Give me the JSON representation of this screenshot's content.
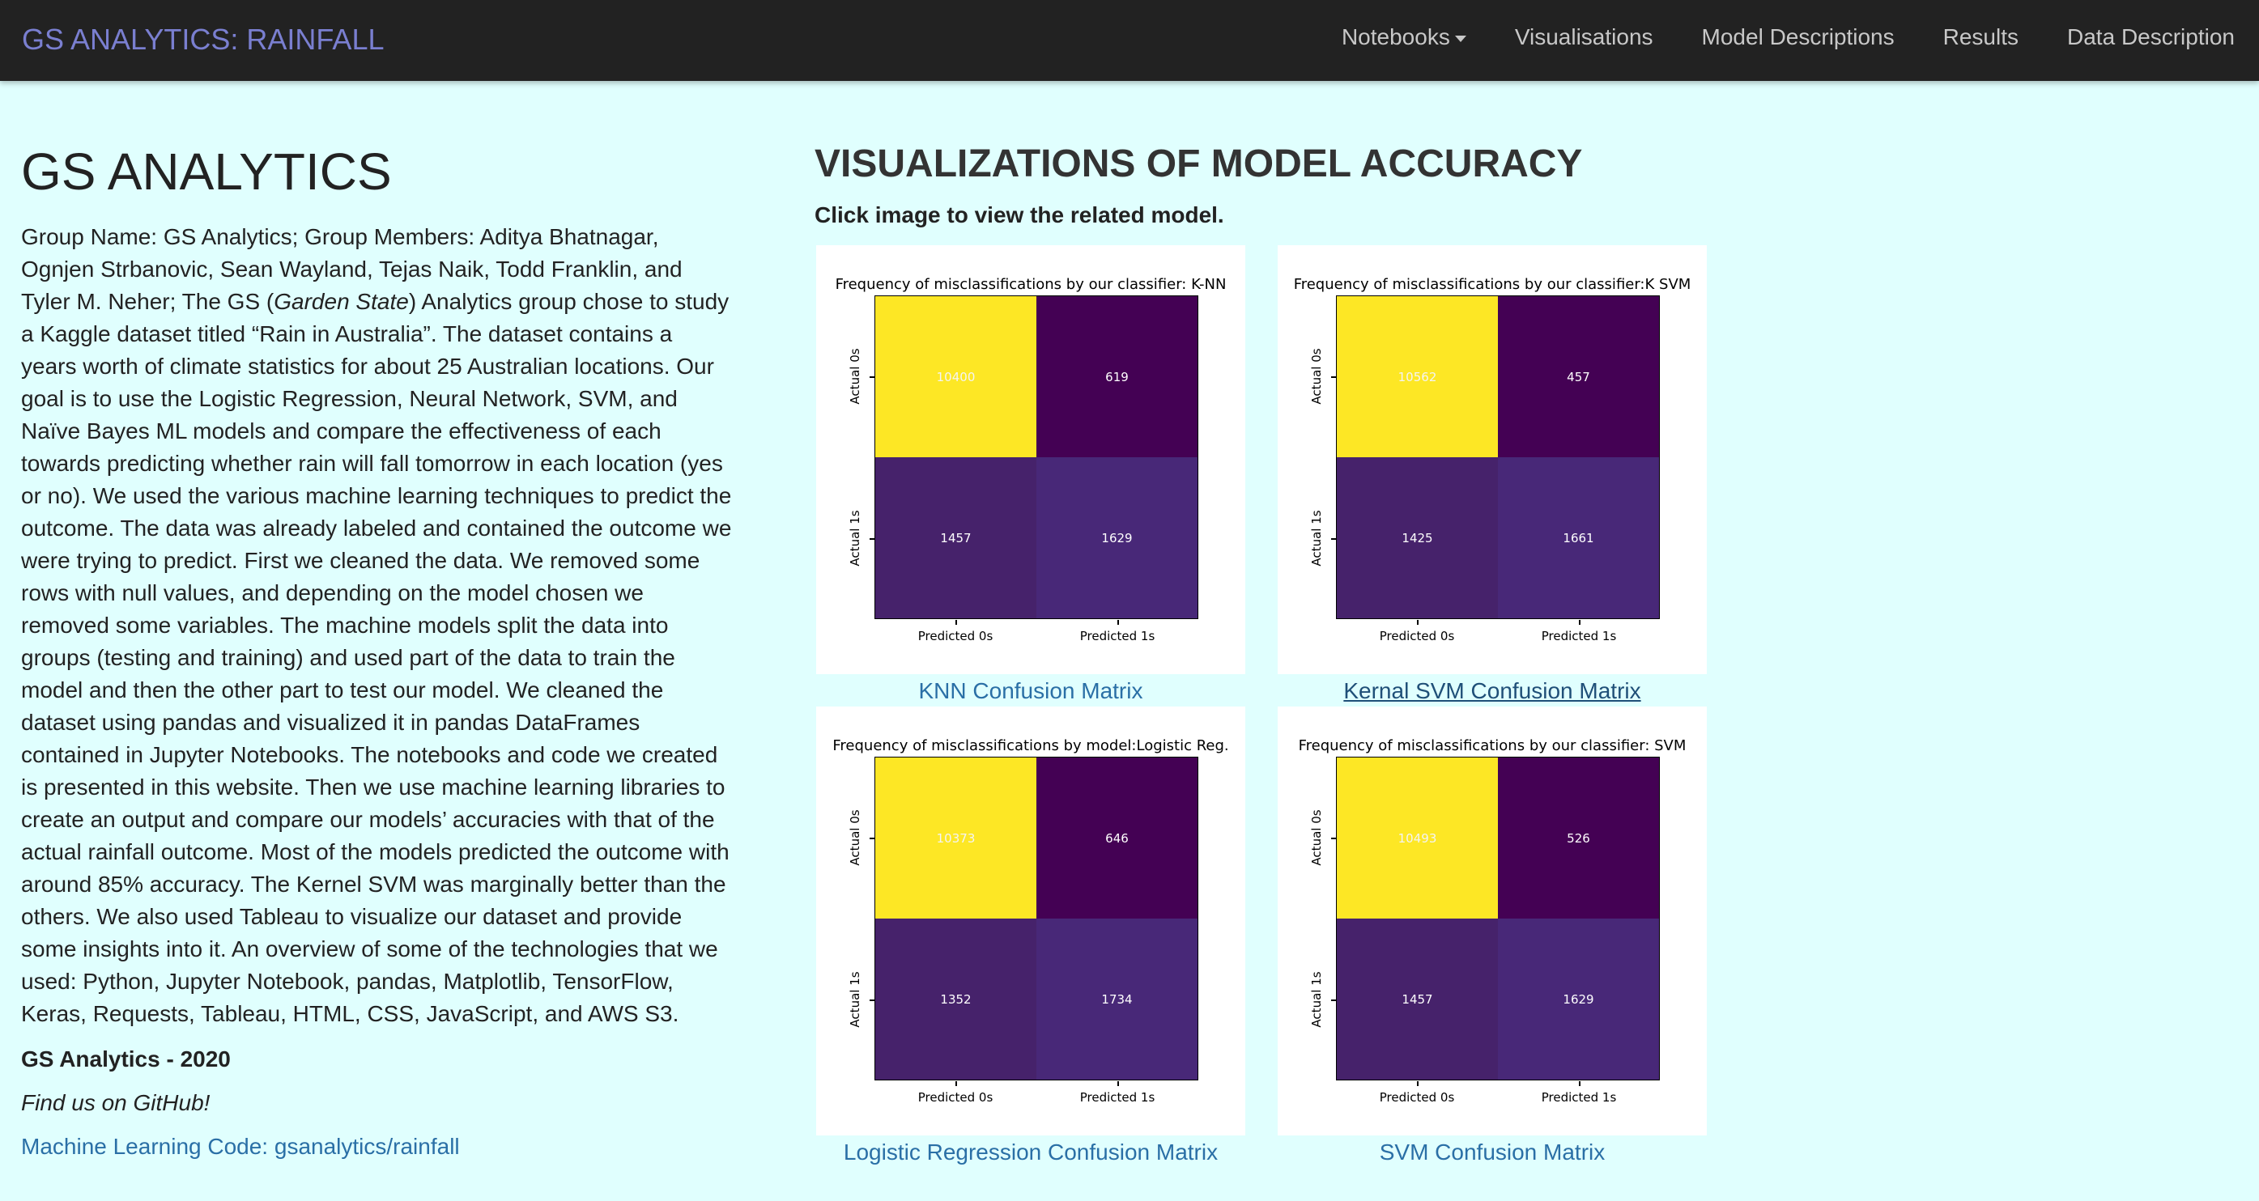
{
  "navbar": {
    "brand": "GS ANALYTICS: RAINFALL",
    "items": [
      {
        "label": "Notebooks",
        "dropdown": true
      },
      {
        "label": "Visualisations"
      },
      {
        "label": "Model Descriptions"
      },
      {
        "label": "Results"
      },
      {
        "label": "Data Description"
      }
    ]
  },
  "left": {
    "heading": "GS ANALYTICS",
    "para_part1": "Group Name: GS Analytics; Group Members: Aditya Bhatnagar, Ognjen Strbanovic, Sean Wayland, Tejas Naik, Todd Franklin, and Tyler M. Neher; The GS (",
    "para_italic": "Garden State",
    "para_part2": ") Analytics group chose to study a Kaggle dataset titled “Rain in Australia”. The dataset contains a years worth of climate statistics for about 25 Australian locations. Our goal is to use the Logistic Regression, Neural Network, SVM, and Naïve Bayes ML models and compare the effectiveness of each towards predicting whether rain will fall tomorrow in each location (yes or no). We used the various machine learning techniques to predict the outcome. The data was already labeled and contained the outcome we were trying to predict. First we cleaned the data. We removed some rows with null values, and depending on the model chosen we removed some variables. The machine models split the data into groups (testing and training) and used part of the data to train the model and then the other part to test our model. We cleaned the dataset using pandas and visualized it in pandas DataFrames contained in Jupyter Notebooks. The notebooks and code we created is presented in this website. Then we use machine learning libraries to create an output and compare our models’ accuracies with that of the actual rainfall outcome. Most of the models predicted the outcome with around 85% accuracy. The Kernel SVM was marginally better than the others. We also used Tableau to visualize our dataset and provide some insights into it. An overview of some of the technologies that we used: Python, Jupyter Notebook, pandas, Matplotlib, TensorFlow, Keras, Requests, Tableau, HTML, CSS, JavaScript, and AWS S3.",
    "footer_year": "GS Analytics - 2020",
    "github_text": "Find us on GitHub!",
    "code_link": "Machine Learning Code: gsanalytics/rainfall"
  },
  "right": {
    "heading": "VISUALIZATIONS OF MODEL ACCURACY",
    "subheading": "Click image to view the related model."
  },
  "colors": {
    "yellow": "#fde725",
    "dark_purple": "#440154",
    "purple_mid": "#46226b",
    "purple_low": "#482878"
  },
  "chart_data": [
    {
      "type": "heatmap",
      "title": "Frequency of misclassifications by our classifier: K-NN",
      "caption": "KNN Confusion Matrix",
      "rows": [
        "Actual 0s",
        "Actual 1s"
      ],
      "cols": [
        "Predicted 0s",
        "Predicted 1s"
      ],
      "values": [
        [
          10400,
          619
        ],
        [
          1457,
          1629
        ]
      ]
    },
    {
      "type": "heatmap",
      "title": "Frequency of misclassifications by our classifier:K SVM",
      "caption": "Kernal SVM Confusion Matrix",
      "rows": [
        "Actual 0s",
        "Actual 1s"
      ],
      "cols": [
        "Predicted 0s",
        "Predicted 1s"
      ],
      "values": [
        [
          10562,
          457
        ],
        [
          1425,
          1661
        ]
      ]
    },
    {
      "type": "heatmap",
      "title": "Frequency of misclassifications by model:Logistic Reg.",
      "caption": "Logistic Regression Confusion Matrix",
      "rows": [
        "Actual 0s",
        "Actual 1s"
      ],
      "cols": [
        "Predicted 0s",
        "Predicted 1s"
      ],
      "values": [
        [
          10373,
          646
        ],
        [
          1352,
          1734
        ]
      ]
    },
    {
      "type": "heatmap",
      "title": "Frequency of misclassifications by our classifier: SVM",
      "caption": "SVM Confusion Matrix",
      "rows": [
        "Actual 0s",
        "Actual 1s"
      ],
      "cols": [
        "Predicted 0s",
        "Predicted 1s"
      ],
      "values": [
        [
          10493,
          526
        ],
        [
          1457,
          1629
        ]
      ]
    }
  ]
}
